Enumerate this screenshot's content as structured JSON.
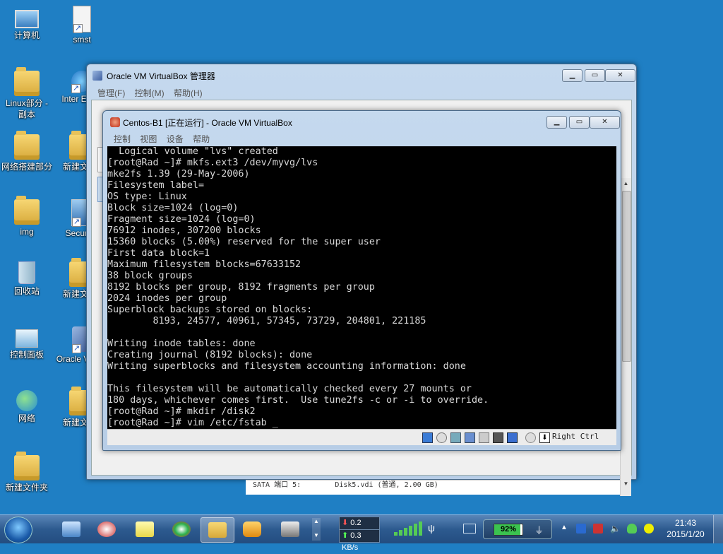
{
  "desktop": {
    "icons": [
      {
        "label": "计算机"
      },
      {
        "label": "smst"
      },
      {
        "label": "Linux部分 - 副本"
      },
      {
        "label": "Inter Explo"
      },
      {
        "label": "网络搭建部分"
      },
      {
        "label": "新建文 (2)"
      },
      {
        "label": "img"
      },
      {
        "label": "SecureC"
      },
      {
        "label": "回收站"
      },
      {
        "label": "新建文 (3)"
      },
      {
        "label": "控制面板"
      },
      {
        "label": "Oracle Virtual"
      },
      {
        "label": "网络"
      },
      {
        "label": "新建文 (4)"
      },
      {
        "label": "新建文件夹"
      }
    ]
  },
  "manager_window": {
    "title": "Oracle VM VirtualBox 管理器",
    "menu": [
      "管理(F)",
      "控制(M)",
      "帮助(H)"
    ],
    "behind_text": "SATA 端口 5:        Disk5.vdi (普通, 2.00 GB)"
  },
  "vm_window": {
    "title": "Centos-B1 [正在运行] - Oracle VM VirtualBox",
    "menu": [
      "控制",
      "视图",
      "设备",
      "帮助"
    ],
    "host_key": "Right Ctrl",
    "terminal_lines": [
      "  Logical volume \"lvs\" created",
      "[root@Rad ~]# mkfs.ext3 /dev/myvg/lvs",
      "mke2fs 1.39 (29-May-2006)",
      "Filesystem label=",
      "OS type: Linux",
      "Block size=1024 (log=0)",
      "Fragment size=1024 (log=0)",
      "76912 inodes, 307200 blocks",
      "15360 blocks (5.00%) reserved for the super user",
      "First data block=1",
      "Maximum filesystem blocks=67633152",
      "38 block groups",
      "8192 blocks per group, 8192 fragments per group",
      "2024 inodes per group",
      "Superblock backups stored on blocks:",
      "        8193, 24577, 40961, 57345, 73729, 204801, 221185",
      "",
      "Writing inode tables: done",
      "Creating journal (8192 blocks): done",
      "Writing superblocks and filesystem accounting information: done",
      "",
      "This filesystem will be automatically checked every 27 mounts or",
      "180 days, whichever comes first.  Use tune2fs -c or -i to override.",
      "[root@Rad ~]# mkdir /disk2",
      "[root@Rad ~]# vim /etc/fstab _"
    ]
  },
  "taskbar": {
    "net_down": "0.2 KB/s",
    "net_up": "0.3 KB/s",
    "battery": "92%",
    "time": "21:43",
    "date": "2015/1/20"
  },
  "colors": {
    "desktop_bg": "#1f7fc4",
    "terminal_bg": "#000000",
    "terminal_fg": "#d8d8d8"
  }
}
